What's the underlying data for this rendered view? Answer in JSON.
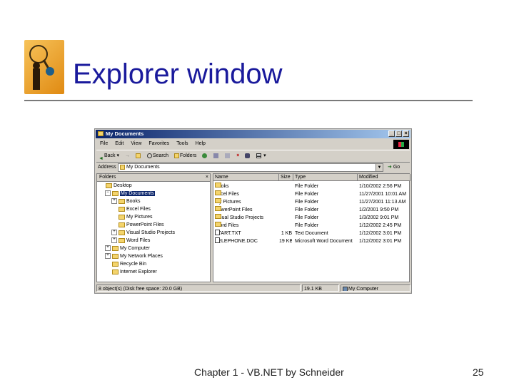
{
  "slide": {
    "title": "Explorer window",
    "footer": "Chapter 1 - VB.NET by Schneider",
    "page_number": "25"
  },
  "window": {
    "title": "My Documents",
    "controls": [
      "_",
      "□",
      "×"
    ],
    "menu": [
      "File",
      "Edit",
      "View",
      "Favorites",
      "Tools",
      "Help"
    ],
    "toolbar": {
      "back": "Back",
      "forward": "→",
      "up": "Up",
      "search": "Search",
      "folders": "Folders",
      "history": "History"
    },
    "address": {
      "label": "Address",
      "value": "My Documents",
      "go": "Go"
    },
    "folders_pane": {
      "header": "Folders",
      "close": "×",
      "tree": [
        {
          "label": "Desktop",
          "level": 0,
          "expander": ""
        },
        {
          "label": "My Documents",
          "level": 1,
          "expander": "−",
          "selected": true
        },
        {
          "label": "Books",
          "level": 2,
          "expander": "+"
        },
        {
          "label": "Excel Files",
          "level": 2,
          "expander": ""
        },
        {
          "label": "My Pictures",
          "level": 2,
          "expander": ""
        },
        {
          "label": "PowerPoint Files",
          "level": 2,
          "expander": ""
        },
        {
          "label": "Visual Studio Projects",
          "level": 2,
          "expander": "+"
        },
        {
          "label": "Word Files",
          "level": 2,
          "expander": "+"
        },
        {
          "label": "My Computer",
          "level": 1,
          "expander": "+"
        },
        {
          "label": "My Network Places",
          "level": 1,
          "expander": "+"
        },
        {
          "label": "Recycle Bin",
          "level": 1,
          "expander": ""
        },
        {
          "label": "Internet Explorer",
          "level": 1,
          "expander": ""
        }
      ]
    },
    "file_list": {
      "columns": [
        "Name",
        "Size",
        "Type",
        "Modified"
      ],
      "rows": [
        {
          "name": "Books",
          "size": "",
          "type": "File Folder",
          "modified": "1/10/2002 2:56 PM",
          "kind": "folder"
        },
        {
          "name": "Excel Files",
          "size": "",
          "type": "File Folder",
          "modified": "11/27/2001 10:01 AM",
          "kind": "folder"
        },
        {
          "name": "My Pictures",
          "size": "",
          "type": "File Folder",
          "modified": "11/27/2001 11:13 AM",
          "kind": "folder"
        },
        {
          "name": "PowerPoint Files",
          "size": "",
          "type": "File Folder",
          "modified": "1/2/2001 9:50 PM",
          "kind": "folder"
        },
        {
          "name": "Visual Studio Projects",
          "size": "",
          "type": "File Folder",
          "modified": "1/3/2002 9:01 PM",
          "kind": "folder"
        },
        {
          "name": "Word Files",
          "size": "",
          "type": "File Folder",
          "modified": "1/12/2002 2:45 PM",
          "kind": "folder"
        },
        {
          "name": "START.TXT",
          "size": "1 KB",
          "type": "Text Document",
          "modified": "1/12/2002 3:01 PM",
          "kind": "file"
        },
        {
          "name": "TELEPHONE.DOC",
          "size": "19 KB",
          "type": "Microsoft Word Document",
          "modified": "1/12/2002 3:01 PM",
          "kind": "file"
        }
      ]
    },
    "status": {
      "objects": "8 object(s) (Disk free space: 20.0 GB)",
      "size": "19.1 KB",
      "location": "My Computer"
    }
  }
}
